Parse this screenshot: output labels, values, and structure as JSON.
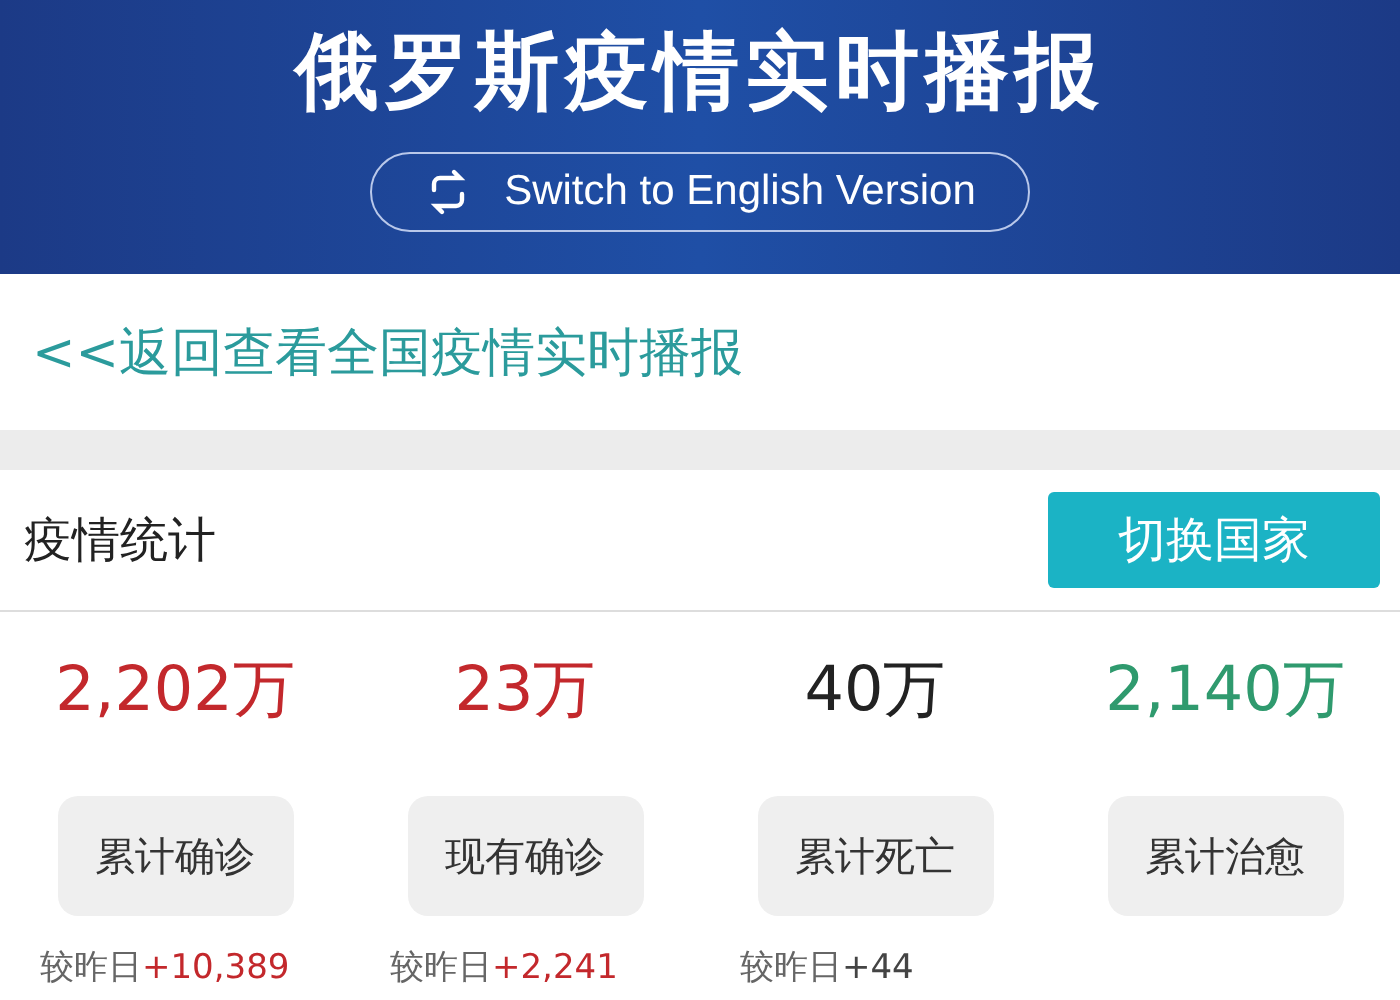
{
  "header": {
    "title": "俄罗斯疫情实时播报",
    "language_button": "Switch to English Version"
  },
  "back_link": "<<返回查看全国疫情实时播报",
  "stats_card": {
    "title": "疫情统计",
    "switch_button": "切换国家",
    "stats": [
      {
        "value": "2,202万",
        "label": "累计确诊",
        "color": "#c3282c",
        "delta_label": "较昨日",
        "delta": "+10,389"
      },
      {
        "value": "23万",
        "label": "现有确诊",
        "color": "#c3282c",
        "delta_label": "较昨日",
        "delta": "+2,241"
      },
      {
        "value": "40万",
        "label": "累计死亡",
        "color": "#222222",
        "delta_label": "较昨日",
        "delta": "+44"
      },
      {
        "value": "2,140万",
        "label": "累计治愈",
        "color": "#2f9a6e"
      }
    ]
  }
}
